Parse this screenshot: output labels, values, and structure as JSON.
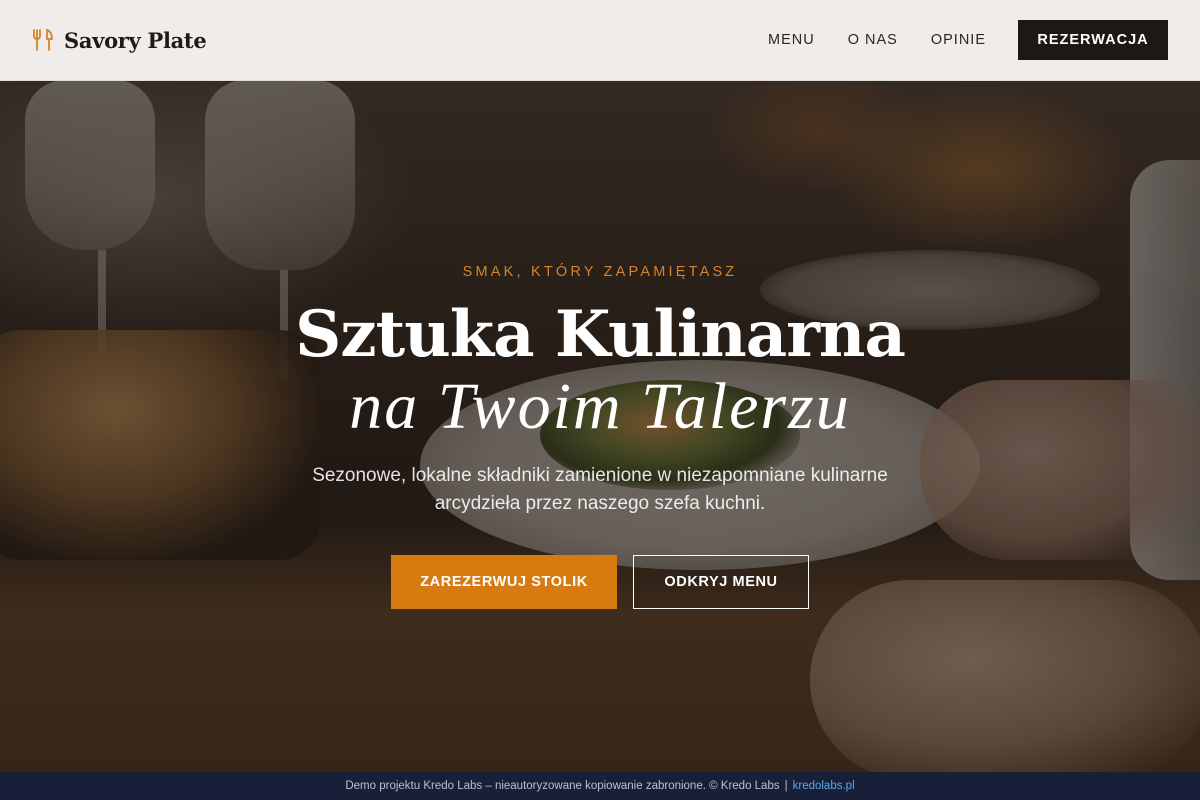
{
  "brand": {
    "name": "Savory Plate",
    "icon": "fork-knife-icon",
    "accent_color": "#d7822c"
  },
  "nav": {
    "items": [
      {
        "label": "MENU"
      },
      {
        "label": "O NAS"
      },
      {
        "label": "OPINIE"
      }
    ],
    "cta_label": "REZERWACJA"
  },
  "hero": {
    "eyebrow": "SMAK, KTÓRY ZAPAMIĘTASZ",
    "title_line1": "Sztuka Kulinarna",
    "title_line2": "na Twoim Talerzu",
    "subtitle": "Sezonowe, lokalne składniki zamienione w niezapomniane kulinarne arcydzieła przez naszego szefa kuchni.",
    "primary_button": "ZAREZERWUJ STOLIK",
    "secondary_button": "ODKRYJ MENU",
    "primary_color": "#d77a10"
  },
  "footer": {
    "notice": "Demo projektu Kredo Labs – nieautoryzowane kopiowanie zabronione. © Kredo Labs",
    "separator": "|",
    "link_text": "kredolabs.pl"
  }
}
